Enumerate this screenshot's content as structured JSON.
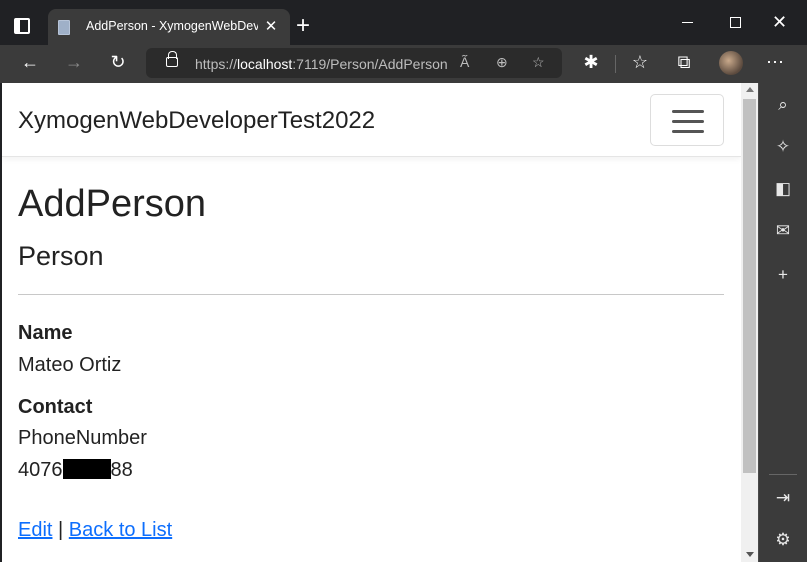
{
  "browser": {
    "tab_title": "AddPerson - XymogenWebDevel",
    "tab_close": "✕",
    "new_tab": "+",
    "url_prefix": "https://",
    "url_host": "localhost",
    "url_path": ":7119/Person/AddPerson",
    "icons": [
      "tab-actions",
      "favicon",
      "back",
      "forward",
      "refresh",
      "lock",
      "read-aloud",
      "zoom",
      "add-favorite",
      "extensions",
      "favorites",
      "collections",
      "profile",
      "more",
      "minimize",
      "maximize",
      "close"
    ]
  },
  "page": {
    "brand": "XymogenWebDeveloperTest2022",
    "heading": "AddPerson",
    "subheading": "Person",
    "name_label": "Name",
    "name_value": "Mateo Ortiz",
    "contact_label": "Contact",
    "contact_type": "PhoneNumber",
    "phone_start": "4076",
    "phone_end": "88",
    "edit_link": "Edit",
    "link_separator": "|",
    "back_link": "Back to List"
  },
  "sidebar": {
    "icons": [
      "search",
      "copilot",
      "office",
      "outlook",
      "add",
      "split-screen",
      "settings"
    ]
  },
  "colors": {
    "link": "#0d6efd",
    "chrome_dark": "#202124",
    "toolbar": "#3b3b3b"
  }
}
